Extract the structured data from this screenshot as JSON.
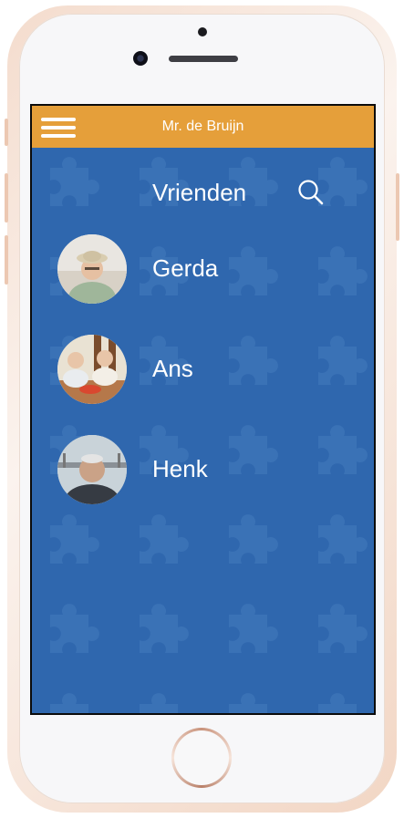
{
  "header": {
    "user_name": "Mr. de Bruijn"
  },
  "page": {
    "title": "Vrienden"
  },
  "friends": [
    {
      "name": "Gerda"
    },
    {
      "name": "Ans"
    },
    {
      "name": "Henk"
    }
  ],
  "colors": {
    "header": "#e59f3a",
    "background": "#2f67ae",
    "text": "#ffffff"
  },
  "icons": {
    "menu": "hamburger-menu-icon",
    "search": "search-icon"
  }
}
